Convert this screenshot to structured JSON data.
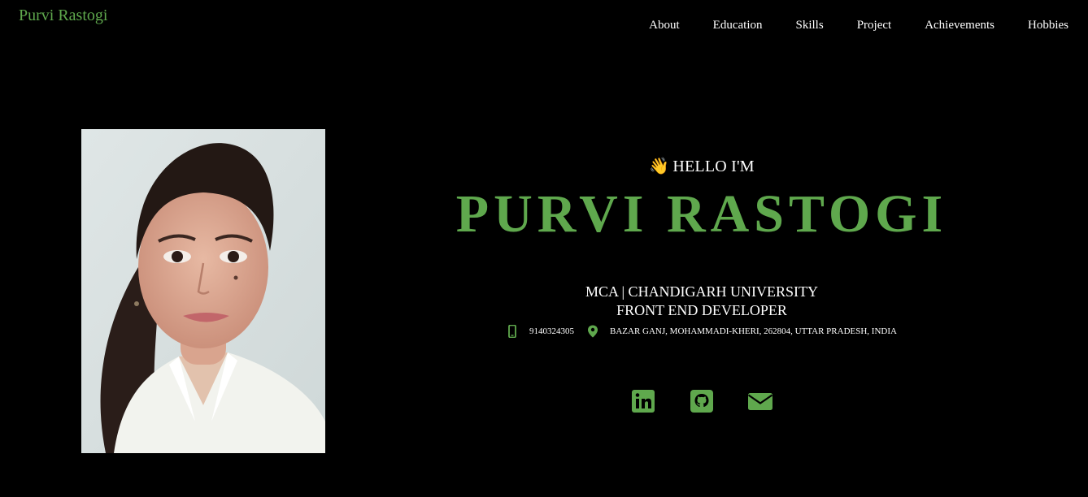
{
  "header": {
    "brand": "Purvi Rastogi",
    "nav": [
      {
        "label": "About"
      },
      {
        "label": "Education"
      },
      {
        "label": "Skills"
      },
      {
        "label": "Project"
      },
      {
        "label": "Achievements"
      },
      {
        "label": "Hobbies"
      }
    ]
  },
  "hero": {
    "wave_icon": "waving-hand-icon",
    "greeting": "HELLO I'M",
    "name": "PURVI RASTOGI",
    "line1": "MCA | CHANDIGARH UNIVERSITY",
    "line2": "FRONT END DEVELOPER",
    "phone": "9140324305",
    "address": "BAZAR GANJ, MOHAMMADI-KHERI, 262804, UTTAR PRADESH, INDIA",
    "socials": [
      {
        "icon": "linkedin-icon"
      },
      {
        "icon": "github-icon"
      },
      {
        "icon": "envelope-icon"
      }
    ]
  },
  "colors": {
    "accent": "#5fa84d",
    "background": "#000000",
    "text": "#ffffff"
  }
}
